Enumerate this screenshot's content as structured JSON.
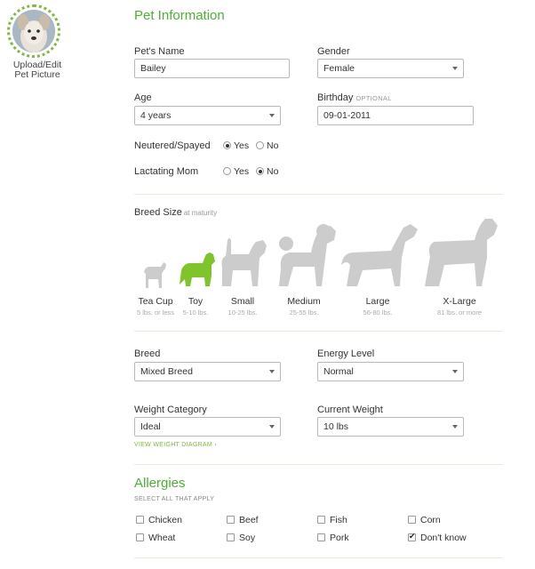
{
  "avatar": {
    "caption_line1": "Upload/Edit",
    "caption_line2": "Pet Picture"
  },
  "pet_info": {
    "title": "Pet Information",
    "name": {
      "label": "Pet's Name",
      "value": "Bailey"
    },
    "gender": {
      "label": "Gender",
      "value": "Female"
    },
    "age": {
      "label": "Age",
      "value": "4 years"
    },
    "birthday": {
      "label": "Birthday",
      "optional": "OPTIONAL",
      "value": "09-01-2011"
    },
    "neutered": {
      "label": "Neutered/Spayed",
      "yes": "Yes",
      "no": "No",
      "selected": "yes"
    },
    "lactating": {
      "label": "Lactating Mom",
      "yes": "Yes",
      "no": "No",
      "selected": "no"
    }
  },
  "breed_size": {
    "label": "Breed Size",
    "sublabel": "at maturity",
    "selected": "toy",
    "active_color": "#7fc42a",
    "inactive_color": "#cccccc",
    "sizes": [
      {
        "name": "Tea Cup",
        "range": "5 lbs. or less"
      },
      {
        "name": "Toy",
        "range": "5-10 lbs."
      },
      {
        "name": "Small",
        "range": "10-25 lbs."
      },
      {
        "name": "Medium",
        "range": "25-55 lbs."
      },
      {
        "name": "Large",
        "range": "56-80 lbs."
      },
      {
        "name": "X-Large",
        "range": "81 lbs. or more"
      }
    ]
  },
  "details": {
    "breed": {
      "label": "Breed",
      "value": "Mixed Breed"
    },
    "energy": {
      "label": "Energy Level",
      "value": "Normal"
    },
    "weight_category": {
      "label": "Weight Category",
      "value": "Ideal"
    },
    "current_weight": {
      "label": "Current Weight",
      "value": "10 lbs"
    },
    "weight_diagram_link": "VIEW WEIGHT DIAGRAM ›"
  },
  "allergies": {
    "title": "Allergies",
    "instruction": "SELECT ALL THAT APPLY",
    "items": [
      {
        "label": "Chicken",
        "checked": false
      },
      {
        "label": "Beef",
        "checked": false
      },
      {
        "label": "Fish",
        "checked": false
      },
      {
        "label": "Corn",
        "checked": false
      },
      {
        "label": "Wheat",
        "checked": false
      },
      {
        "label": "Soy",
        "checked": false
      },
      {
        "label": "Pork",
        "checked": false
      },
      {
        "label": "Don't know",
        "checked": true
      }
    ]
  },
  "colors": {
    "accent": "#49b234",
    "link": "#7fba3c",
    "divider": "#e6ecd5"
  }
}
